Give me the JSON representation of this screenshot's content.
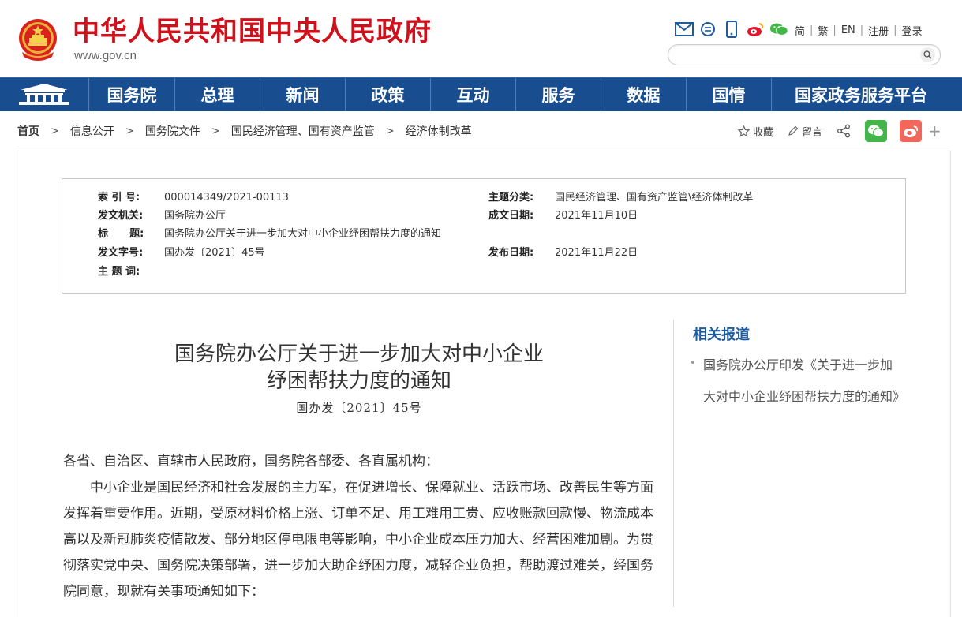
{
  "header": {
    "title": "中华人民共和国中央人民政府",
    "url": "www.gov.cn",
    "icons": [
      "mail-icon",
      "message-icon",
      "mobile-icon",
      "weibo-icon",
      "wechat-icon"
    ],
    "links": [
      "简",
      "繁",
      "EN",
      "注册",
      "登录"
    ],
    "search_placeholder": ""
  },
  "nav": {
    "items": [
      "国务院",
      "总理",
      "新闻",
      "政策",
      "互动",
      "服务",
      "数据",
      "国情",
      "国家政务服务平台"
    ]
  },
  "breadcrumb": [
    "首页",
    "信息公开",
    "国务院文件",
    "国民经济管理、国有资产监管",
    "经济体制改革"
  ],
  "tools": {
    "favorite": "收藏",
    "comment": "留言",
    "more": "+"
  },
  "meta": {
    "index_label": "索 引 号:",
    "index_value": "000014349/2021-00113",
    "category_label": "主题分类:",
    "category_value": "国民经济管理、国有资产监管\\经济体制改革",
    "issuer_label": "发文机关:",
    "issuer_value": "国务院办公厅",
    "written_label": "成文日期:",
    "written_value": "2021年11月10日",
    "title_label": "标      题:",
    "title_value": "国务院办公厅关于进一步加大对中小企业纾困帮扶力度的通知",
    "doc_no_label": "发文字号:",
    "doc_no_value": "国办发〔2021〕45号",
    "published_label": "发布日期:",
    "published_value": "2021年11月22日",
    "keywords_label": "主 题 词:",
    "keywords_value": ""
  },
  "article": {
    "title_line1": "国务院办公厅关于进一步加大对中小企业",
    "title_line2": "纾困帮扶力度的通知",
    "doc_no": "国办发〔2021〕45号",
    "salutation": "各省、自治区、直辖市人民政府，国务院各部委、各直属机构：",
    "paragraph1": "中小企业是国民经济和社会发展的主力军，在促进增长、保障就业、活跃市场、改善民生等方面发挥着重要作用。近期，受原材料价格上涨、订单不足、用工难用工贵、应收账款回款慢、物流成本高以及新冠肺炎疫情散发、部分地区停电限电等影响，中小企业成本压力加大、经营困难加剧。为贯彻落实党中央、国务院决策部署，进一步加大助企纾困力度，减轻企业负担，帮助渡过难关，经国务院同意，现就有关事项通知如下："
  },
  "sidebar": {
    "heading": "相关报道",
    "items": [
      "国务院办公厅印发《关于进一步加大对中小企业纾困帮扶力度的通知》"
    ]
  },
  "colors": {
    "brand_red": "#d0111b",
    "nav_blue": "#184e8f",
    "link_blue": "#1d5a9e"
  }
}
